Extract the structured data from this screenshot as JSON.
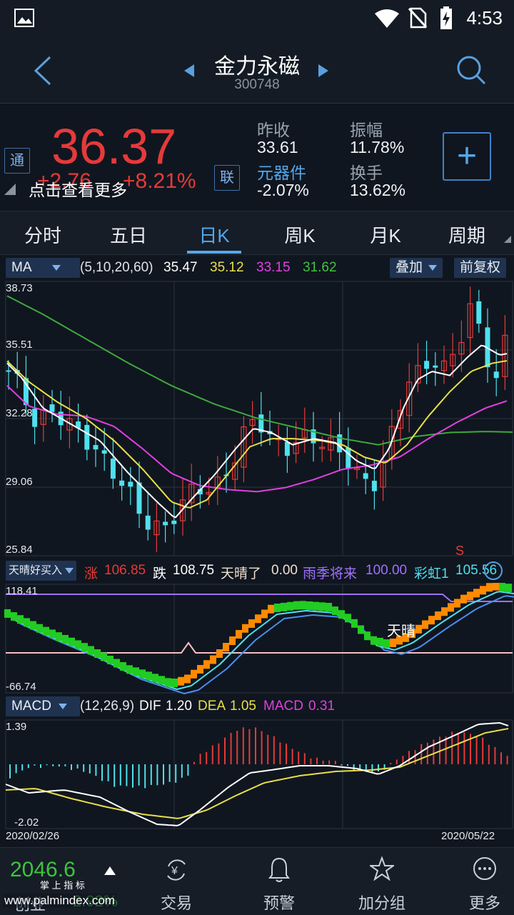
{
  "status_bar": {
    "time": "4:53",
    "icons": [
      "image-icon",
      "wifi-icon",
      "no-sim-icon",
      "battery-charging-icon"
    ]
  },
  "header": {
    "stock_name": "金力永磁",
    "stock_code": "300748",
    "back_icon": "chevron-left-icon",
    "prev_icon": "triangle-left-icon",
    "next_icon": "triangle-right-icon",
    "search_icon": "search-icon"
  },
  "quote": {
    "price": "36.37",
    "change": "+2.76",
    "change_pct": "+8.21%",
    "tong_badge": "通",
    "lian_badge": "联",
    "hint": "点击查看更多",
    "prev_close_label": "昨收",
    "prev_close": "33.61",
    "amplitude_label": "振幅",
    "amplitude": "11.78%",
    "sector_label": "元器件",
    "sector_change": "-2.07%",
    "turnover_label": "换手",
    "turnover": "13.62%",
    "add_label": "+"
  },
  "tabs": [
    "分时",
    "五日",
    "日K",
    "周K",
    "月K",
    "周期"
  ],
  "active_tab": "日K",
  "ma_bar": {
    "selector": "MA",
    "params": "(5,10,20,60)",
    "ma5": "35.47",
    "ma10": "35.12",
    "ma20": "33.15",
    "ma60": "31.62",
    "overlay": "叠加",
    "adjust": "前复权"
  },
  "kline_axis": {
    "ticks": [
      "38.73",
      "35.51",
      "32.28",
      "29.06",
      "25.84"
    ],
    "s_marker": "S"
  },
  "ind2_bar": {
    "selector": "天晴好买入",
    "zhang_label": "涨",
    "zhang": "106.85",
    "die_label": "跌",
    "die": "108.75",
    "tianqing_label": "天晴了",
    "tianqing": "0.00",
    "yuji_label": "雨季将来",
    "yuji": "100.00",
    "caihong_label": "彩虹1",
    "caihong": "105.56"
  },
  "ind2_axis": {
    "top": "118.41",
    "bottom": "-66.74",
    "annotation": "天晴"
  },
  "macd_bar": {
    "selector": "MACD",
    "params": "(12,26,9)",
    "dif_label": "DIF",
    "dif": "1.20",
    "dea_label": "DEA",
    "dea": "1.05",
    "macd_label": "MACD",
    "macd": "0.31"
  },
  "macd_axis": {
    "top": "1.39",
    "bottom": "-2.02",
    "start_date": "2020/02/26",
    "end_date": "2020/05/22"
  },
  "bottom_nav": {
    "index_value": "2046.6",
    "index_name": "创业",
    "index_change": "2.92%",
    "items": [
      {
        "label": "交易",
        "icon": "yen-exchange-icon"
      },
      {
        "label": "预警",
        "icon": "bell-icon"
      },
      {
        "label": "加分组",
        "icon": "star-icon"
      },
      {
        "label": "更多",
        "icon": "more-icon"
      }
    ],
    "watermark": "掌 上 指 标",
    "watermark_url": "www.palmindex.com"
  },
  "colors": {
    "up": "#e53a3a",
    "down": "#4fe0ee",
    "ma5": "#ffffff",
    "ma10": "#e8e04a",
    "ma20": "#e040e0",
    "ma60": "#3ea83e",
    "accent": "#53a7ec"
  }
}
